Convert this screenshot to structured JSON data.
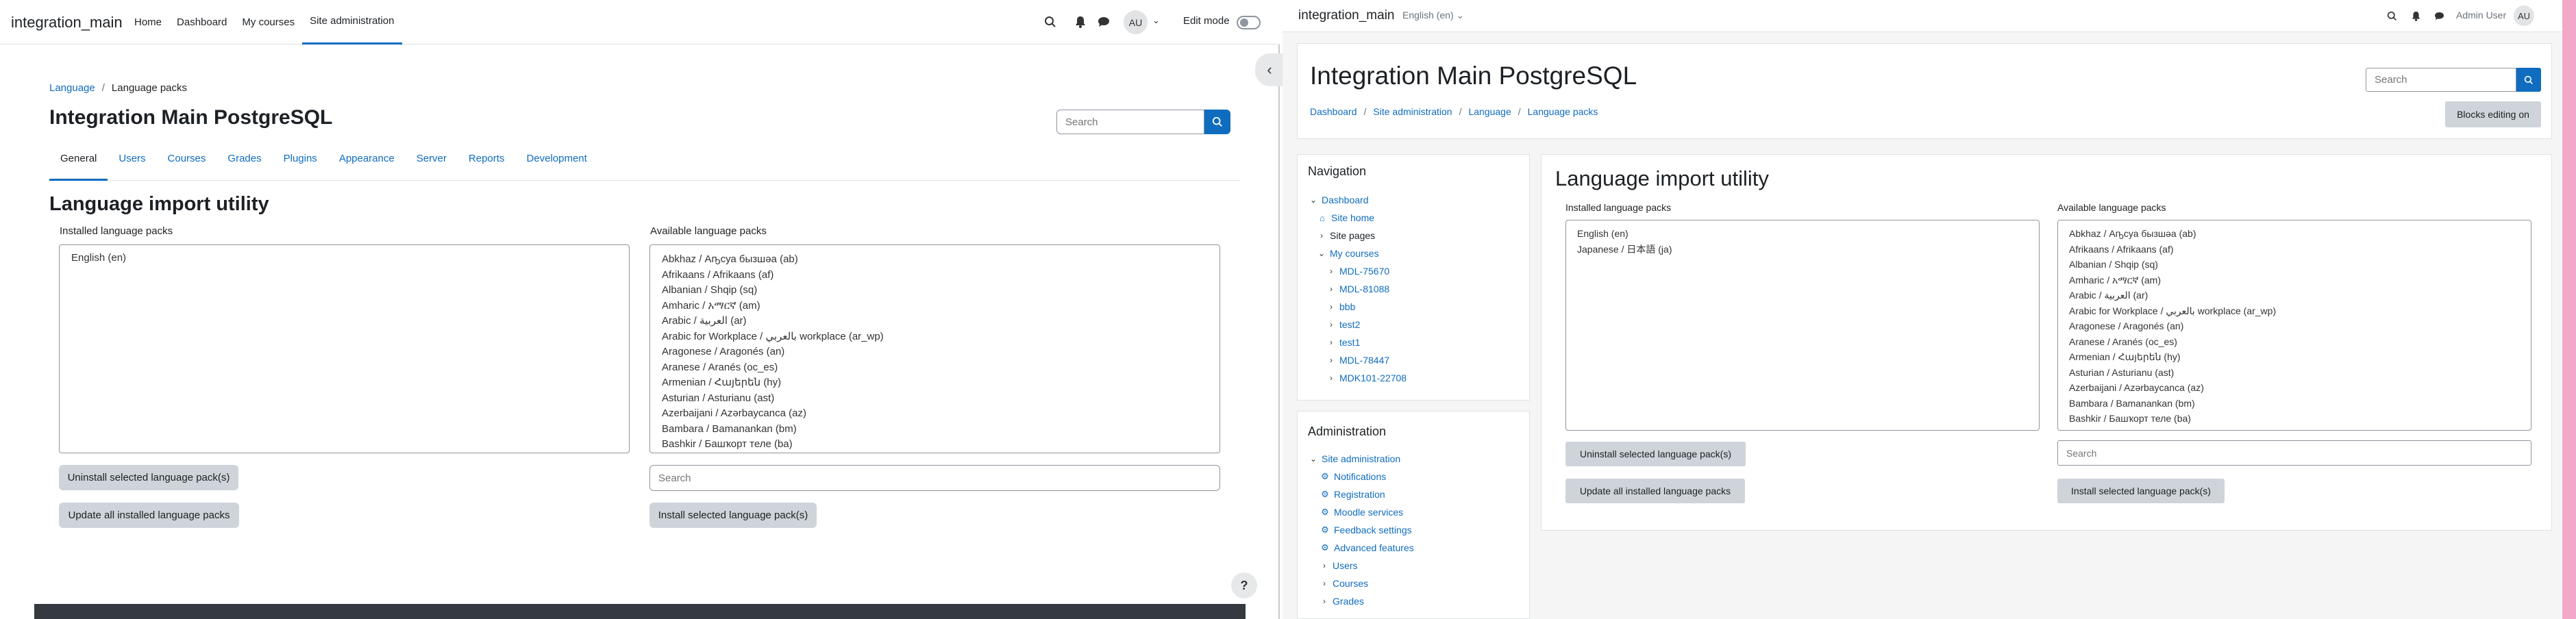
{
  "left": {
    "brand": "integration_main",
    "nav": [
      {
        "label": "Home"
      },
      {
        "label": "Dashboard"
      },
      {
        "label": "My courses"
      },
      {
        "label": "Site administration",
        "active": true
      }
    ],
    "user_initials": "AU",
    "edit_mode_label": "Edit mode",
    "breadcrumb": [
      {
        "label": "Language",
        "link": true
      },
      {
        "label": "Language packs",
        "link": false
      }
    ],
    "site_title": "Integration Main PostgreSQL",
    "search_placeholder": "Search",
    "tabs": [
      {
        "label": "General",
        "active": true
      },
      {
        "label": "Users"
      },
      {
        "label": "Courses"
      },
      {
        "label": "Grades"
      },
      {
        "label": "Plugins"
      },
      {
        "label": "Appearance"
      },
      {
        "label": "Server"
      },
      {
        "label": "Reports"
      },
      {
        "label": "Development"
      }
    ],
    "page_heading": "Language import utility",
    "installed_label": "Installed language packs",
    "installed_packs": [
      "English (en)"
    ],
    "available_label": "Available language packs",
    "available_packs": [
      "Abkhaz / Аҧсуа бызшәа (ab)",
      "Afrikaans / Afrikaans (af)",
      "Albanian / Shqip (sq)",
      "Amharic / አማርኛ (am)",
      "Arabic / العربية (ar)",
      "Arabic for Workplace / بالعربي workplace (ar_wp)",
      "Aragonese / Aragonés (an)",
      "Aranese / Aranés (oc_es)",
      "Armenian / Հայերեն (hy)",
      "Asturian / Asturianu (ast)",
      "Azerbaijani / Azərbaycanca (az)",
      "Bambara / Bamanankan (bm)",
      "Bashkir / Башҡорт теле (ba)"
    ],
    "uninstall_button": "Uninstall selected language pack(s)",
    "update_button": "Update all installed language packs",
    "available_search_placeholder": "Search",
    "install_button": "Install selected language pack(s)",
    "help_symbol": "?"
  },
  "right": {
    "brand": "integration_main",
    "language": "English (en)",
    "user_name": "Admin User",
    "user_initials": "AU",
    "site_title": "Integration Main PostgreSQL",
    "search_placeholder": "Search",
    "breadcrumb": [
      {
        "label": "Dashboard"
      },
      {
        "label": "Site administration"
      },
      {
        "label": "Language"
      },
      {
        "label": "Language packs"
      }
    ],
    "blocks_editing_button": "Blocks editing on",
    "navigation": {
      "title": "Navigation",
      "items": [
        {
          "label": "Dashboard",
          "level": 0,
          "chev": "v",
          "link": true
        },
        {
          "label": "Site home",
          "level": 1,
          "icon": "home",
          "link": true
        },
        {
          "label": "Site pages",
          "level": 1,
          "chev": ">",
          "link": false
        },
        {
          "label": "My courses",
          "level": 1,
          "chev": "v",
          "link": true
        },
        {
          "label": "MDL-75670",
          "level": 2,
          "chev": ">",
          "link": true
        },
        {
          "label": "MDL-81088",
          "level": 2,
          "chev": ">",
          "link": true
        },
        {
          "label": "bbb",
          "level": 2,
          "chev": ">",
          "link": true
        },
        {
          "label": "test2",
          "level": 2,
          "chev": ">",
          "link": true
        },
        {
          "label": "test1",
          "level": 2,
          "chev": ">",
          "link": true
        },
        {
          "label": "MDL-78447",
          "level": 2,
          "chev": ">",
          "link": true
        },
        {
          "label": "MDK101-22708",
          "level": 2,
          "chev": ">",
          "link": true
        }
      ]
    },
    "administration": {
      "title": "Administration",
      "items": [
        {
          "label": "Site administration",
          "level": 0,
          "chev": "v",
          "link": true
        },
        {
          "label": "Notifications",
          "level": 1,
          "icon": "gear",
          "link": true
        },
        {
          "label": "Registration",
          "level": 1,
          "icon": "gear",
          "link": true
        },
        {
          "label": "Moodle services",
          "level": 1,
          "icon": "gear",
          "link": true
        },
        {
          "label": "Feedback settings",
          "level": 1,
          "icon": "gear",
          "link": true
        },
        {
          "label": "Advanced features",
          "level": 1,
          "icon": "gear",
          "link": true
        },
        {
          "label": "Users",
          "level": 1,
          "chev": ">",
          "link": true
        },
        {
          "label": "Courses",
          "level": 1,
          "chev": ">",
          "link": true
        },
        {
          "label": "Grades",
          "level": 1,
          "chev": ">",
          "link": true
        }
      ]
    },
    "page_heading": "Language import utility",
    "installed_label": "Installed language packs",
    "installed_packs": [
      "English (en)",
      "Japanese / 日本語 (ja)"
    ],
    "available_label": "Available language packs",
    "available_packs": [
      "Abkhaz / Аҧсуа бызшәа (ab)",
      "Afrikaans / Afrikaans (af)",
      "Albanian / Shqip (sq)",
      "Amharic / አማርኛ (am)",
      "Arabic / العربية (ar)",
      "Arabic for Workplace / بالعربي workplace (ar_wp)",
      "Aragonese / Aragonés (an)",
      "Aranese / Aranés (oc_es)",
      "Armenian / Հայերեն (hy)",
      "Asturian / Asturianu (ast)",
      "Azerbaijani / Azərbaycanca (az)",
      "Bambara / Bamanankan (bm)",
      "Bashkir / Башҡорт теле (ba)"
    ],
    "available_search_placeholder": "Search",
    "uninstall_button": "Uninstall selected language pack(s)",
    "update_button": "Update all installed language packs",
    "install_button": "Install selected language pack(s)"
  }
}
